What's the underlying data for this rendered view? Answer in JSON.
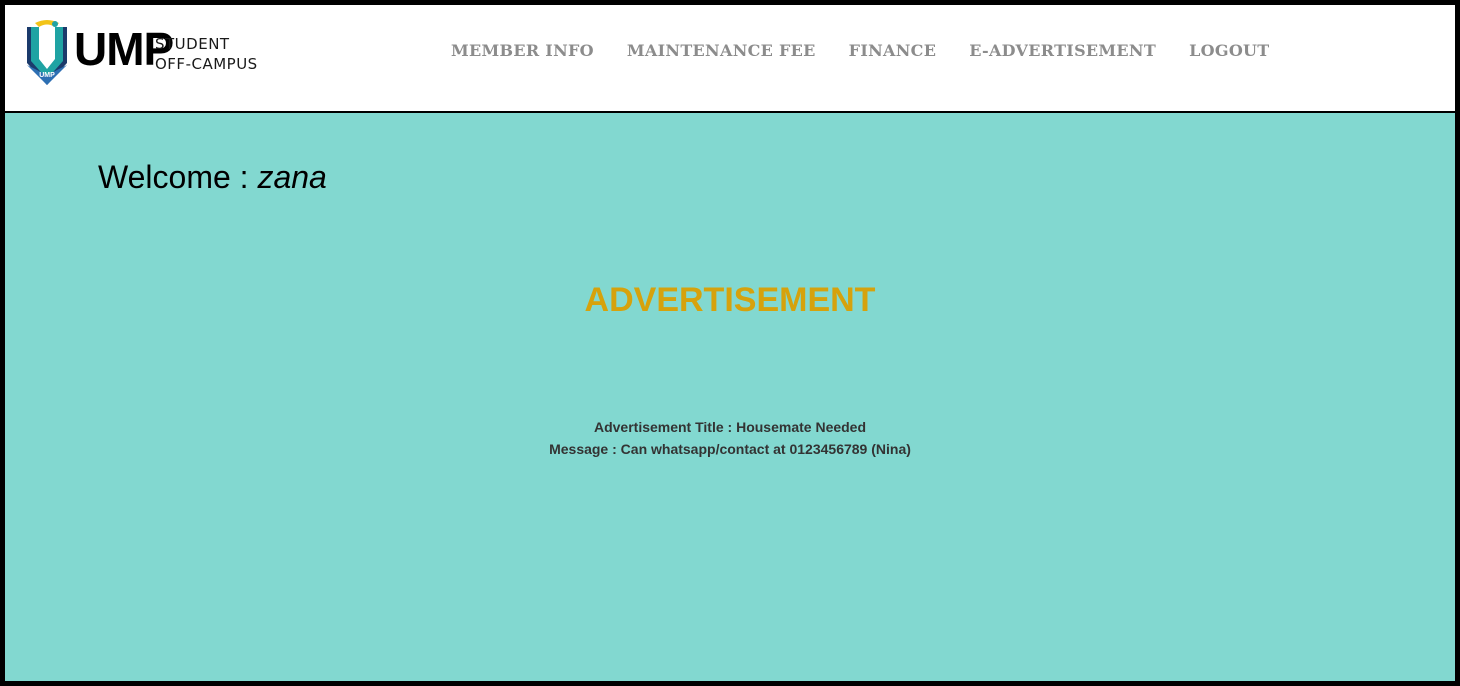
{
  "logo": {
    "brand": "UMP",
    "tagline_line1": "STUDENT",
    "tagline_line2": "OFF-CAMPUS",
    "badge_text": "UMP",
    "colors": {
      "shield_teal": "#1fa3a3",
      "shield_navy": "#1b3a6b",
      "shield_yellow": "#f2c418"
    }
  },
  "nav": {
    "items": [
      {
        "label": "MEMBER INFO"
      },
      {
        "label": "MAINTENANCE FEE"
      },
      {
        "label": "FINANCE"
      },
      {
        "label": "E-ADVERTISEMENT"
      },
      {
        "label": "LOGOUT"
      }
    ]
  },
  "welcome": {
    "prefix": "Welcome : ",
    "username": "zana"
  },
  "page": {
    "heading": "ADVERTISEMENT"
  },
  "advertisement": {
    "title_label": "Advertisement Title : ",
    "title_value": "Housemate Needed",
    "message_label": "Message : ",
    "message_value": "Can whatsapp/contact at 0123456789 (Nina)"
  },
  "colors": {
    "background": "#82d8d0",
    "header_bg": "#ffffff",
    "nav_text": "#8c8c8c",
    "heading": "#d6a20c",
    "frame": "#000000"
  }
}
